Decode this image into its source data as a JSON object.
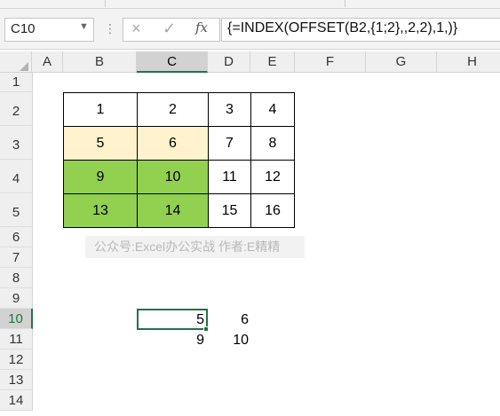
{
  "formula_bar": {
    "name_box": "C10",
    "formula": "{=INDEX(OFFSET(B2,{1;2},,2,2),1,)}",
    "cancel_icon": "×",
    "enter_icon": "✓",
    "fx_icon": "fx"
  },
  "columns": [
    "A",
    "B",
    "C",
    "D",
    "E",
    "F",
    "G",
    "H"
  ],
  "selected_column": "C",
  "rows": [
    "1",
    "2",
    "3",
    "4",
    "5",
    "6",
    "7",
    "8",
    "9",
    "10",
    "11",
    "12",
    "13",
    "14"
  ],
  "selected_row": "10",
  "table": [
    [
      "1",
      "2",
      "3",
      "4"
    ],
    [
      "5",
      "6",
      "7",
      "8"
    ],
    [
      "9",
      "10",
      "11",
      "12"
    ],
    [
      "13",
      "14",
      "15",
      "16"
    ]
  ],
  "result": {
    "row10": [
      "5",
      "6"
    ],
    "row11": [
      "9",
      "10"
    ]
  },
  "watermark": "公众号:Excel办公实战  作者:E精精",
  "colors": {
    "highlight_yellow": "#fff2cc",
    "highlight_green": "#92d050",
    "excel_green": "#217346"
  }
}
